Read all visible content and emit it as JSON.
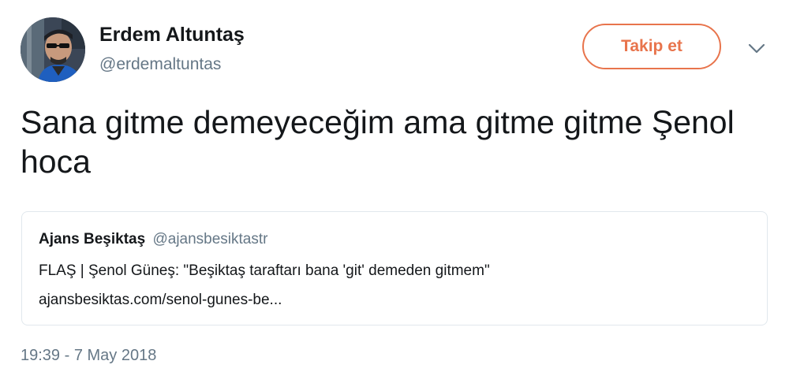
{
  "author": {
    "name": "Erdem Altuntaş",
    "handle": "@erdemaltuntas",
    "avatar_icon": "profile-photo"
  },
  "follow_button": {
    "label": "Takip et",
    "color": "#e8744c"
  },
  "menu": {
    "icon": "chevron-down-icon"
  },
  "tweet": {
    "text": "Sana gitme demeyeceğim ama gitme gitme Şenol hoca",
    "timestamp": "19:39 - 7 May 2018"
  },
  "quote": {
    "author_name": "Ajans Beşiktaş",
    "author_handle": "@ajansbesiktastr",
    "text": "FLAŞ | Şenol Güneş: \"Beşiktaş taraftarı bana 'git' demeden gitmem\"",
    "link": "ajansbesiktas.com/senol-gunes-be..."
  }
}
